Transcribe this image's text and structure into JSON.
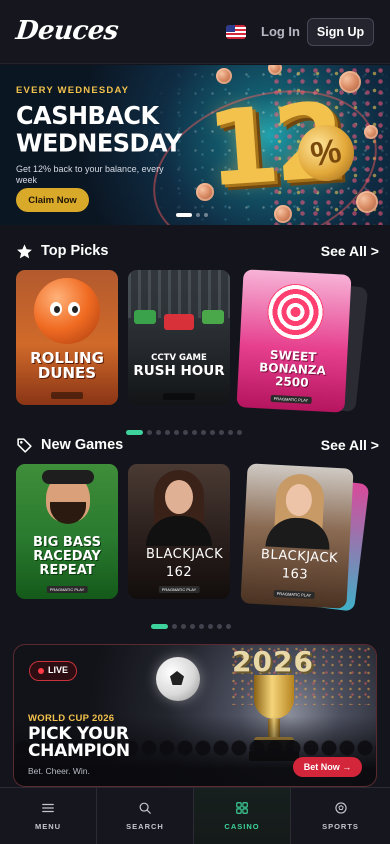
{
  "header": {
    "logo": "Deuces",
    "login_label": "Log In",
    "signup_label": "Sign Up"
  },
  "hero": {
    "eyebrow": "EVERY WEDNESDAY",
    "title": "CASHBACK WEDNESDAY",
    "subtitle": "Get 12% back to your balance, every week",
    "cta": "Claim Now",
    "art_number": "12",
    "art_percent": "%",
    "slide_count": 3,
    "active_slide": 0
  },
  "top_picks": {
    "title": "Top Picks",
    "see_all": "See All >",
    "icon": "star-icon",
    "cards": [
      {
        "title": "ROLLING DUNES",
        "bg": "#c95f2a"
      },
      {
        "title_small": "CCTV GAME",
        "title": "RUSH HOUR",
        "bg": "#2b2e33"
      },
      {
        "title": "SWEET BONANZA 2500",
        "provider": "PRAGMATIC PLAY",
        "bg": "#e0317f"
      }
    ],
    "page_count": 12,
    "active_page": 0
  },
  "new_games": {
    "title": "New Games",
    "see_all": "See All >",
    "icon": "tag-icon",
    "cards": [
      {
        "title": "BIG BASS RACEDAY REPEAT",
        "provider": "PRAGMATIC PLAY",
        "bg": "#2d7a2f"
      },
      {
        "title": "BLACKJACK 162",
        "provider": "PRAGMATIC PLAY",
        "bg": "#2a1f1c"
      },
      {
        "title": "BLACKJACK 163",
        "provider": "PRAGMATIC PLAY",
        "bg": "#4a3222"
      }
    ],
    "page_count": 8,
    "active_page": 0
  },
  "worldcup": {
    "live": "LIVE",
    "art_year": "2026",
    "eyebrow": "WORLD CUP 2026",
    "title": "PICK YOUR CHAMPION",
    "tagline": "Bet. Cheer. Win.",
    "cta": "Bet Now →"
  },
  "bottom_nav": [
    {
      "label": "MENU",
      "icon": "menu-icon",
      "active": false
    },
    {
      "label": "SEARCH",
      "icon": "search-icon",
      "active": false
    },
    {
      "label": "CASINO",
      "icon": "grid-icon",
      "active": true
    },
    {
      "label": "SPORTS",
      "icon": "sports-icon",
      "active": false
    }
  ],
  "colors": {
    "accent_green": "#3ed39c",
    "gold": "#f2c24c",
    "cta_red": "#d4263a",
    "background": "#14151c"
  }
}
